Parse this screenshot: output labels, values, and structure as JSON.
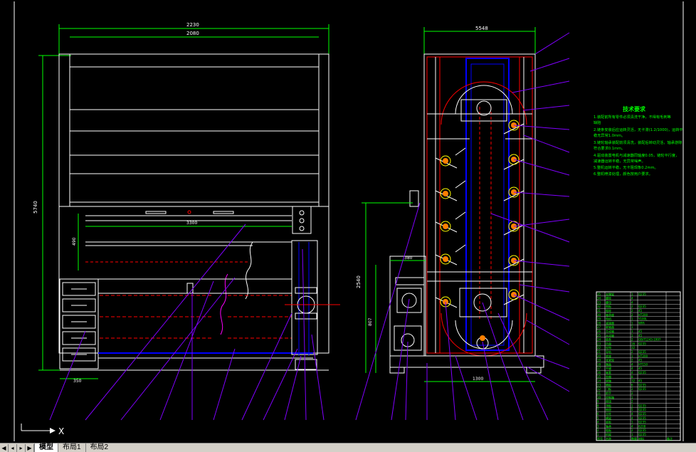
{
  "tabs": {
    "nav_first": "◀",
    "nav_prev": "◂",
    "nav_next": "▸",
    "nav_last": "▶",
    "model": "模型",
    "layout1": "布局1",
    "layout2": "布局2"
  },
  "dimensions": {
    "left_total_width": "2230",
    "left_inner_width": "2080",
    "left_height": "5740",
    "left_small": "490",
    "left_mid_width": "3300",
    "left_bottom": "350",
    "right_top_width": "5548",
    "right_height_1": "2540",
    "right_height_2": "807",
    "right_small": "380",
    "right_bottom": "1300"
  },
  "notes": {
    "title": "技术要求",
    "lines": [
      "1.装配前所有零件必须清洗干净，不得有毛刺等",
      "缺陷",
      "2.链条安装后应运转灵活，无卡滞(1.2/1000)，运转平",
      "稳无异常1.0mm。",
      "3.链轮轴承装配前须清洗，装配后转动灵活，轴承游隙",
      "符合要求0.1mm。",
      "4.驱动装置电机与减速器同轴度0.05，链轮平行度，",
      "减速器运转平稳，无异常噪声。",
      "5.整机运转平稳，无卡阻现象0.2mm。",
      "6.整机喷漆处理，颜色按用户要求。"
    ]
  },
  "title_block": {
    "rows": [
      [
        "35",
        "支撑架",
        "1",
        "Q235",
        ""
      ],
      [
        "34",
        "螺栓",
        "4",
        "",
        ""
      ],
      [
        "33",
        "螺母",
        "4",
        "",
        ""
      ],
      [
        "32",
        "侧板",
        "2",
        "Q235",
        ""
      ],
      [
        "31",
        "链轮",
        "2",
        "45",
        ""
      ],
      [
        "30",
        "轴承座",
        "2",
        "HT200",
        ""
      ],
      [
        "29",
        "电机",
        "1",
        "Y100L",
        ""
      ],
      [
        "28",
        "减速器",
        "1",
        "WPA",
        ""
      ],
      [
        "27",
        "联轴器",
        "1",
        "",
        ""
      ],
      [
        "26",
        "主动轴",
        "1",
        "45",
        ""
      ],
      [
        "25",
        "从动轴",
        "1",
        "45",
        ""
      ],
      [
        "24",
        "链条",
        "2",
        "GB/T1243-1997",
        ""
      ],
      [
        "23",
        "托盘",
        "16",
        "Q235",
        ""
      ],
      [
        "22",
        "挂钩",
        "32",
        "",
        ""
      ],
      [
        "21",
        "导轨",
        "2",
        "Q235",
        ""
      ],
      [
        "20",
        "底座",
        "1",
        "HT200",
        ""
      ],
      [
        "19",
        "张紧轮",
        "2",
        "45",
        ""
      ],
      [
        "18",
        "端盖",
        "4",
        "HT150",
        ""
      ],
      [
        "17",
        "平键",
        "4",
        "45",
        ""
      ],
      [
        "16",
        "轴套",
        "4",
        "Q235",
        ""
      ],
      [
        "15",
        "垫圈",
        "8",
        "",
        ""
      ],
      [
        "14",
        "销轴",
        "32",
        "45",
        ""
      ],
      [
        "13",
        "隔板",
        "6",
        "Q235",
        ""
      ],
      [
        "12",
        "门板",
        "2",
        "Q235",
        ""
      ],
      [
        "11",
        "把手",
        "2",
        "",
        ""
      ],
      [
        "10",
        "控制箱",
        "1",
        "",
        ""
      ],
      [
        "9",
        "按钮",
        "2",
        "",
        ""
      ],
      [
        "8",
        "顶板",
        "1",
        "Q235",
        ""
      ],
      [
        "7",
        "抽屉",
        "5",
        "Q235",
        ""
      ],
      [
        "6",
        "立柱",
        "4",
        "Q235",
        ""
      ],
      [
        "5",
        "横梁",
        "4",
        "Q235",
        ""
      ],
      [
        "4",
        "底板",
        "1",
        "Q235",
        ""
      ],
      [
        "3",
        "轴承",
        "4",
        "6208",
        ""
      ],
      [
        "2",
        "链板",
        "2",
        "Q235",
        ""
      ],
      [
        "1",
        "机架",
        "1",
        "Q235",
        ""
      ],
      [
        "序号",
        "名称",
        "数量",
        "材料",
        "备注"
      ]
    ]
  },
  "ucs_label": "X",
  "colors": {
    "background": "#000000",
    "white": "#ffffff",
    "green": "#00ff00",
    "red": "#ff0000",
    "blue": "#0000ff",
    "purple": "#8000ff",
    "yellow": "#ffff00",
    "orange": "#ff8000"
  }
}
